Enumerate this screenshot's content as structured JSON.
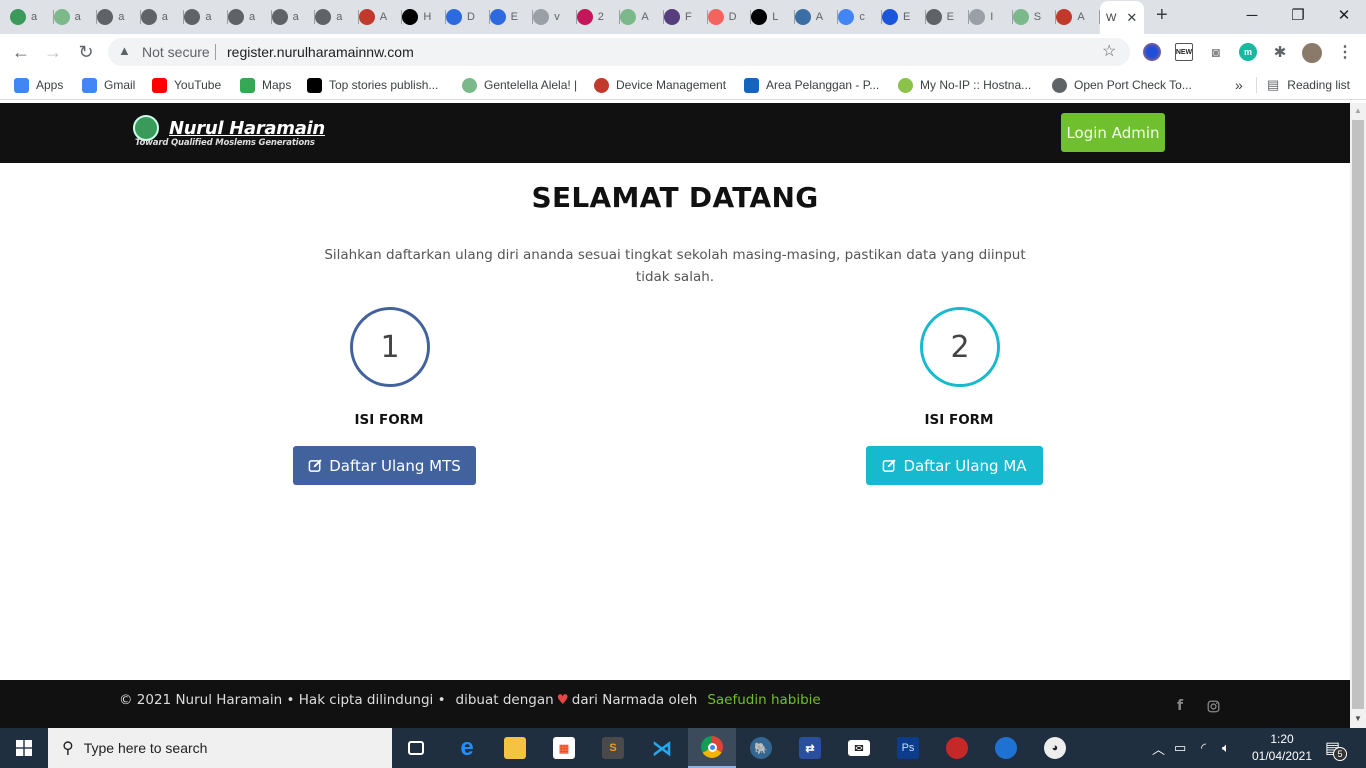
{
  "browser": {
    "tabs": [
      {
        "title": "a",
        "icon": "green-emblem-icon",
        "color": "#3a9a5a"
      },
      {
        "title": "a",
        "icon": "green-emblem-icon",
        "color": "#7bb88a"
      },
      {
        "title": "a",
        "icon": "globe-icon",
        "color": "#5f6368"
      },
      {
        "title": "a",
        "icon": "globe-icon",
        "color": "#5f6368"
      },
      {
        "title": "a",
        "icon": "globe-icon",
        "color": "#5f6368"
      },
      {
        "title": "a",
        "icon": "globe-icon",
        "color": "#5f6368"
      },
      {
        "title": "a",
        "icon": "globe-icon",
        "color": "#5f6368"
      },
      {
        "title": "a",
        "icon": "globe-icon",
        "color": "#5f6368"
      },
      {
        "title": "A",
        "icon": "house-icon",
        "color": "#c0392b"
      },
      {
        "title": "H",
        "icon": "aw-icon",
        "color": "#000000"
      },
      {
        "title": "D",
        "icon": "blue-square-icon",
        "color": "#2d6ae0"
      },
      {
        "title": "E",
        "icon": "blue-square-icon",
        "color": "#2d6ae0"
      },
      {
        "title": "v",
        "icon": "globe-icon",
        "color": "#9aa0a6"
      },
      {
        "title": "2",
        "icon": "bitdefender-icon",
        "color": "#c2185b"
      },
      {
        "title": "A",
        "icon": "green-emblem-icon",
        "color": "#7bb88a"
      },
      {
        "title": "F",
        "icon": "bootstrap-icon",
        "color": "#563d7c"
      },
      {
        "title": "D",
        "icon": "laravel-icon",
        "color": "#f4645f"
      },
      {
        "title": "L",
        "icon": "j-icon",
        "color": "#000000"
      },
      {
        "title": "A",
        "icon": "send-icon",
        "color": "#3b6ea5"
      },
      {
        "title": "c",
        "icon": "google-icon",
        "color": "#4285f4"
      },
      {
        "title": "E",
        "icon": "e-icon",
        "color": "#1a56db"
      },
      {
        "title": "E",
        "icon": "globe-icon",
        "color": "#5f6368"
      },
      {
        "title": "I",
        "icon": "apple-icon",
        "color": "#9aa0a6"
      },
      {
        "title": "S",
        "icon": "green-emblem-icon",
        "color": "#7bb88a"
      },
      {
        "title": "A",
        "icon": "house-icon",
        "color": "#c0392b"
      }
    ],
    "active_tab": {
      "title": "W"
    },
    "new_tab_label": "+",
    "address": {
      "security_label": "Not secure",
      "url": "register.nurulharamainnw.com"
    },
    "bookmarks": [
      {
        "label": "Apps",
        "icon": "apps-grid-icon",
        "color": "#4285f4"
      },
      {
        "label": "Gmail",
        "icon": "google-icon",
        "color": "#4285f4"
      },
      {
        "label": "YouTube",
        "icon": "youtube-icon",
        "color": "#ff0000"
      },
      {
        "label": "Maps",
        "icon": "maps-pin-icon",
        "color": "#34a853"
      },
      {
        "label": "Top stories publish...",
        "icon": "medium-icon",
        "color": "#000000"
      },
      {
        "label": "Gentelella Alela! |",
        "icon": "green-emblem-icon",
        "color": "#7bb88a"
      },
      {
        "label": "Device Management",
        "icon": "record-icon",
        "color": "#c0392b"
      },
      {
        "label": "Area Pelanggan - P...",
        "icon": "e-icon",
        "color": "#1565c0"
      },
      {
        "label": "My No-IP :: Hostna...",
        "icon": "noip-icon",
        "color": "#8bc34a"
      },
      {
        "label": "Open Port Check To...",
        "icon": "globe-icon",
        "color": "#5f6368"
      }
    ],
    "more_bookmarks": "»",
    "reading_list": "Reading list"
  },
  "site": {
    "logo": {
      "name": "Nurul Haramain",
      "tagline": "Toward Qualified Moslems Generations"
    },
    "login_button": "Login Admin",
    "title": "SELAMAT DATANG",
    "subtitle": "Silahkan daftarkan ulang diri ananda sesuai tingkat sekolah masing-masing, pastikan data yang diinput tidak salah.",
    "steps": [
      {
        "number": "1",
        "label": "ISI FORM",
        "button": "Daftar Ulang MTS",
        "color": "#42629e"
      },
      {
        "number": "2",
        "label": "ISI FORM",
        "button": "Daftar Ulang MA",
        "color": "#17b9cf"
      }
    ],
    "footer": {
      "copyright": "© 2021 Nurul Haramain • Hak cipta dilindungi •",
      "made_with": "dibuat dengan",
      "heart": "♥",
      "from": "dari Narmada oleh",
      "author": "Saefudin habibie",
      "social": [
        "facebook",
        "instagram"
      ]
    }
  },
  "taskbar": {
    "search_placeholder": "Type here to search",
    "time": "1:20",
    "date": "01/04/2021",
    "notification_count": "5",
    "pinned": [
      "task-view",
      "edge",
      "file-explorer",
      "store",
      "sublime-text",
      "vscode",
      "chrome",
      "postgresql",
      "network-tool",
      "mail",
      "photoshop",
      "red-app",
      "winbox",
      "pgadmin"
    ]
  }
}
